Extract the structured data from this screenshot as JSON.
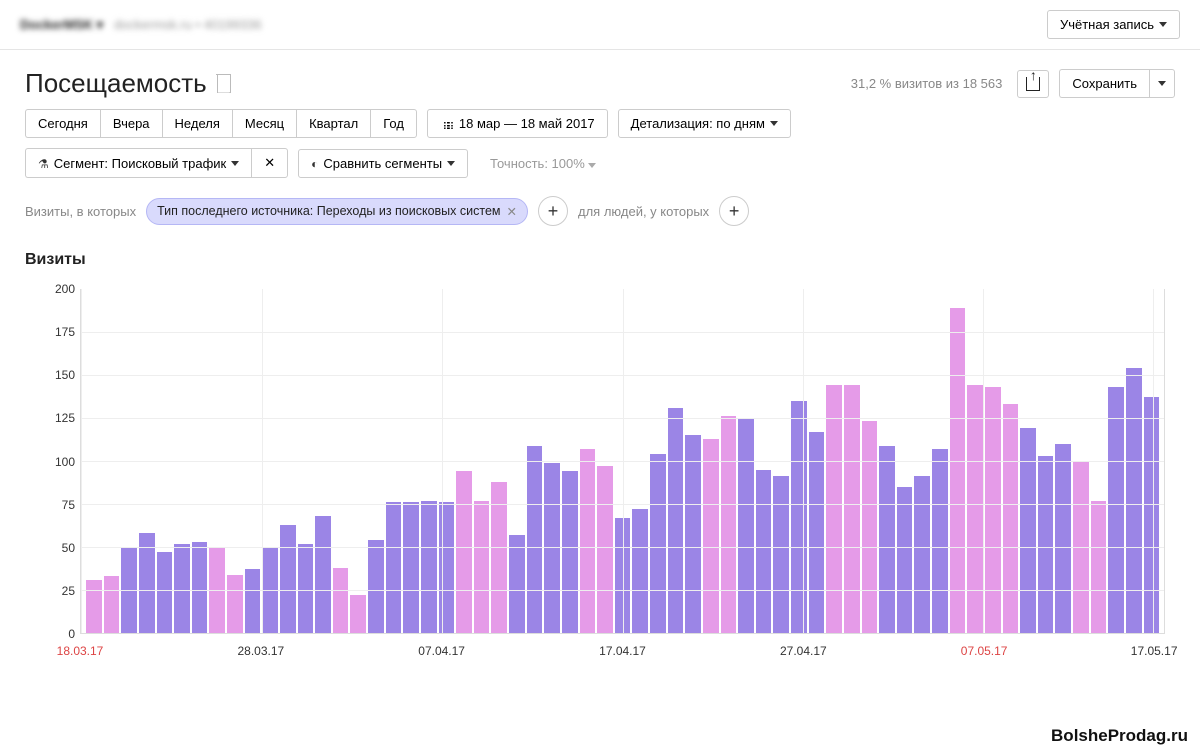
{
  "topbar": {
    "site_name_blur": "DockerMSK",
    "site_url_blur": "dockermsk.ru  •  40199336",
    "account_label": "Учётная запись"
  },
  "header": {
    "title": "Посещаемость",
    "stats": "31,2 % визитов из 18 563",
    "save_label": "Сохранить"
  },
  "period_buttons": [
    "Сегодня",
    "Вчера",
    "Неделя",
    "Месяц",
    "Квартал",
    "Год"
  ],
  "date_range": "18 мар — 18 май 2017",
  "detail": "Детализация: по дням",
  "filters": {
    "segment": "Сегмент: Поисковый трафик",
    "compare": "Сравнить сегменты",
    "precision": "Точность: 100%"
  },
  "segments": {
    "prefix": "Визиты, в которых",
    "tag": "Тип последнего источника: Переходы из поисковых систем",
    "suffix": "для людей, у которых"
  },
  "chart": {
    "title": "Визиты"
  },
  "watermark": "BolsheProdag.ru",
  "chart_data": {
    "type": "bar",
    "title": "Визиты",
    "xlabel": "",
    "ylabel": "",
    "ylim": [
      0,
      200
    ],
    "y_ticks": [
      0,
      25,
      50,
      75,
      100,
      125,
      150,
      175,
      200
    ],
    "x_ticks": [
      {
        "label": "18.03.17",
        "red": true,
        "pos": 0
      },
      {
        "label": "28.03.17",
        "red": false,
        "pos": 16.67
      },
      {
        "label": "07.04.17",
        "red": false,
        "pos": 33.33
      },
      {
        "label": "17.04.17",
        "red": false,
        "pos": 50
      },
      {
        "label": "27.04.17",
        "red": false,
        "pos": 66.67
      },
      {
        "label": "07.05.17",
        "red": true,
        "pos": 83.33
      },
      {
        "label": "17.05.17",
        "red": false,
        "pos": 99
      }
    ],
    "categories": [
      "18.03.17",
      "19.03.17",
      "20.03.17",
      "21.03.17",
      "22.03.17",
      "23.03.17",
      "24.03.17",
      "25.03.17",
      "26.03.17",
      "27.03.17",
      "28.03.17",
      "29.03.17",
      "30.03.17",
      "31.03.17",
      "01.04.17",
      "02.04.17",
      "03.04.17",
      "04.04.17",
      "05.04.17",
      "06.04.17",
      "07.04.17",
      "08.04.17",
      "09.04.17",
      "10.04.17",
      "11.04.17",
      "12.04.17",
      "13.04.17",
      "14.04.17",
      "15.04.17",
      "16.04.17",
      "17.04.17",
      "18.04.17",
      "19.04.17",
      "20.04.17",
      "21.04.17",
      "22.04.17",
      "23.04.17",
      "24.04.17",
      "25.04.17",
      "26.04.17",
      "27.04.17",
      "28.04.17",
      "29.04.17",
      "30.04.17",
      "01.05.17",
      "02.05.17",
      "03.05.17",
      "04.05.17",
      "05.05.17",
      "06.05.17",
      "07.05.17",
      "08.05.17",
      "09.05.17",
      "10.05.17",
      "11.05.17",
      "12.05.17",
      "13.05.17",
      "14.05.17",
      "15.05.17",
      "16.05.17",
      "17.05.17"
    ],
    "values": [
      31,
      33,
      50,
      58,
      47,
      52,
      53,
      50,
      34,
      37,
      50,
      63,
      52,
      68,
      38,
      22,
      54,
      76,
      76,
      77,
      76,
      94,
      77,
      88,
      57,
      109,
      99,
      94,
      107,
      97,
      67,
      72,
      104,
      131,
      115,
      113,
      126,
      125,
      95,
      91,
      135,
      117,
      144,
      144,
      123,
      109,
      85,
      91,
      107,
      189,
      144,
      143,
      133,
      119,
      103,
      110,
      100,
      77,
      143,
      154,
      137
    ],
    "weekend_flags": [
      true,
      true,
      false,
      false,
      false,
      false,
      false,
      true,
      true,
      false,
      false,
      false,
      false,
      false,
      true,
      true,
      false,
      false,
      false,
      false,
      false,
      true,
      true,
      true,
      false,
      false,
      false,
      false,
      true,
      true,
      false,
      false,
      false,
      false,
      false,
      true,
      true,
      false,
      false,
      false,
      false,
      false,
      true,
      true,
      true,
      false,
      false,
      false,
      false,
      true,
      true,
      true,
      true,
      false,
      false,
      false,
      true,
      true,
      false,
      false,
      false
    ]
  }
}
